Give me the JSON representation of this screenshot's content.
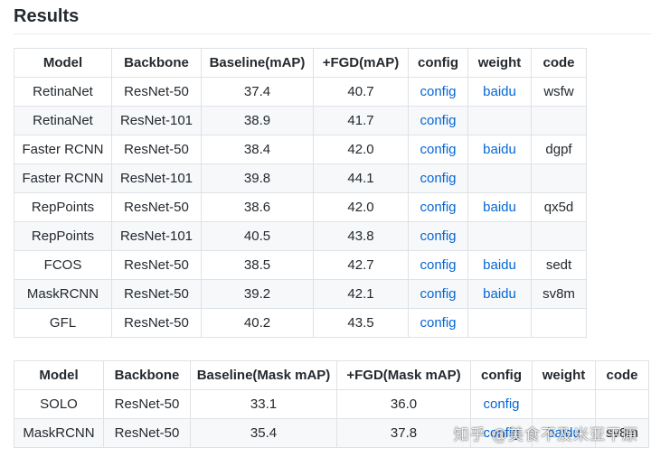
{
  "title": "Results",
  "table1": {
    "headers": [
      "Model",
      "Backbone",
      "Baseline(mAP)",
      "+FGD(mAP)",
      "config",
      "weight",
      "code"
    ],
    "rows": [
      [
        "RetinaNet",
        "ResNet-50",
        "37.4",
        "40.7",
        "config",
        "baidu",
        "wsfw"
      ],
      [
        "RetinaNet",
        "ResNet-101",
        "38.9",
        "41.7",
        "config",
        "",
        ""
      ],
      [
        "Faster RCNN",
        "ResNet-50",
        "38.4",
        "42.0",
        "config",
        "baidu",
        "dgpf"
      ],
      [
        "Faster RCNN",
        "ResNet-101",
        "39.8",
        "44.1",
        "config",
        "",
        ""
      ],
      [
        "RepPoints",
        "ResNet-50",
        "38.6",
        "42.0",
        "config",
        "baidu",
        "qx5d"
      ],
      [
        "RepPoints",
        "ResNet-101",
        "40.5",
        "43.8",
        "config",
        "",
        ""
      ],
      [
        "FCOS",
        "ResNet-50",
        "38.5",
        "42.7",
        "config",
        "baidu",
        "sedt"
      ],
      [
        "MaskRCNN",
        "ResNet-50",
        "39.2",
        "42.1",
        "config",
        "baidu",
        "sv8m"
      ],
      [
        "GFL",
        "ResNet-50",
        "40.2",
        "43.5",
        "config",
        "",
        ""
      ]
    ]
  },
  "table2": {
    "headers": [
      "Model",
      "Backbone",
      "Baseline(Mask mAP)",
      "+FGD(Mask mAP)",
      "config",
      "weight",
      "code"
    ],
    "rows": [
      [
        "SOLO",
        "ResNet-50",
        "33.1",
        "36.0",
        "config",
        "",
        ""
      ],
      [
        "MaskRCNN",
        "ResNet-50",
        "35.4",
        "37.8",
        "config",
        "baidu",
        "sv8m"
      ]
    ]
  },
  "watermark": "知乎 @美食不及米亚平原",
  "colors": {
    "link": "#0366d6",
    "border": "#dfe2e5",
    "stripe": "#f6f8fa",
    "text": "#24292e"
  }
}
